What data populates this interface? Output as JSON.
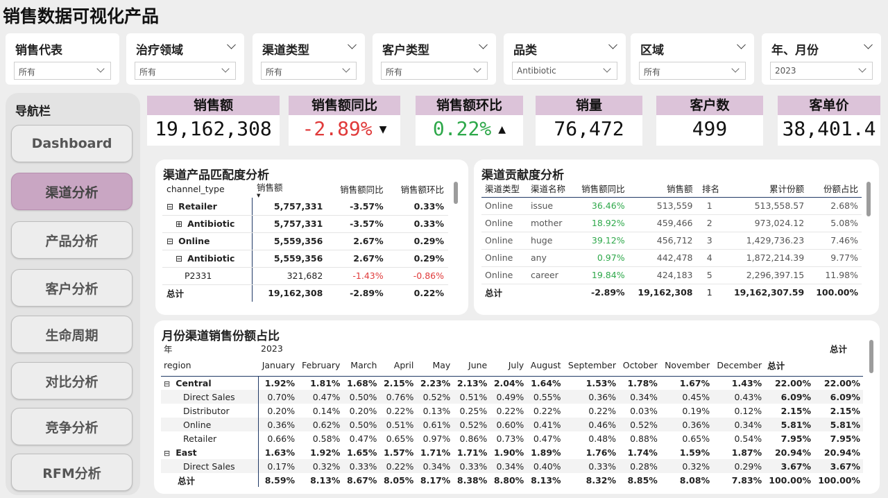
{
  "title": "销售数据可视化产品",
  "slicers": [
    {
      "label": "销售代表",
      "value": "所有"
    },
    {
      "label": "治疗领域",
      "value": "所有"
    },
    {
      "label": "渠道类型",
      "value": "所有"
    },
    {
      "label": "客户类型",
      "value": "所有"
    },
    {
      "label": "品类",
      "value": "Antibiotic"
    },
    {
      "label": "区域",
      "value": "所有"
    },
    {
      "label": "年、月份",
      "value": "2023"
    }
  ],
  "nav": {
    "title": "导航栏",
    "items": [
      "Dashboard",
      "渠道分析",
      "产品分析",
      "客户分析",
      "生命周期",
      "对比分析",
      "竞争分析",
      "RFM分析"
    ],
    "active": 1
  },
  "kpis": [
    {
      "label": "销售额",
      "value": "19,162,308"
    },
    {
      "label": "销售额同比",
      "value": "-2.89%",
      "arrow": "▼"
    },
    {
      "label": "销售额环比",
      "value": "0.22%",
      "arrow": "▲"
    },
    {
      "label": "销量",
      "value": "76,472"
    },
    {
      "label": "客户数",
      "value": "499"
    },
    {
      "label": "客单价",
      "value": "38,401.4"
    }
  ],
  "match": {
    "title": "渠道产品匹配度分析",
    "headers": [
      "channel_type",
      "销售额",
      "销售额同比",
      "销售额环比"
    ],
    "rows": [
      {
        "name": "Retailer",
        "exp": "⊟",
        "level": 0,
        "bold": true,
        "v": [
          "5,757,331",
          "-3.57%",
          "0.33%"
        ]
      },
      {
        "name": "Antibiotic",
        "exp": "⊞",
        "level": 1,
        "bold": true,
        "v": [
          "5,757,331",
          "-3.57%",
          "0.33%"
        ]
      },
      {
        "name": "Online",
        "exp": "⊟",
        "level": 0,
        "bold": true,
        "v": [
          "5,559,356",
          "2.67%",
          "0.29%"
        ]
      },
      {
        "name": "Antibiotic",
        "exp": "⊟",
        "level": 1,
        "bold": true,
        "v": [
          "5,559,356",
          "2.67%",
          "0.29%"
        ]
      },
      {
        "name": "P2331",
        "exp": "",
        "level": 2,
        "bold": false,
        "v": [
          "321,682",
          "-1.43%",
          "-0.86%"
        ],
        "red": true
      },
      {
        "name": "总计",
        "exp": "",
        "level": 0,
        "bold": true,
        "v": [
          "19,162,308",
          "-2.89%",
          "0.22%"
        ]
      }
    ]
  },
  "contrib": {
    "title": "渠道贡献度分析",
    "headers": [
      "渠道类型",
      "渠道名称",
      "销售额同比",
      "销售额",
      "排名",
      "累计份额",
      "份额占比"
    ],
    "rows": [
      [
        "Online",
        "issue",
        "36.46%",
        "513,559",
        "1",
        "513,558.57",
        "2.68%"
      ],
      [
        "Online",
        "mother",
        "18.92%",
        "459,466",
        "2",
        "973,024.12",
        "5.08%"
      ],
      [
        "Online",
        "huge",
        "39.12%",
        "456,712",
        "3",
        "1,429,736.23",
        "7.46%"
      ],
      [
        "Online",
        "any",
        "0.97%",
        "442,478",
        "4",
        "1,872,214.39",
        "9.77%"
      ],
      [
        "Online",
        "career",
        "19.84%",
        "424,183",
        "5",
        "2,296,397.15",
        "11.98%"
      ]
    ],
    "total": [
      "总计",
      "",
      "-2.89%",
      "19,162,308",
      "1",
      "19,162,307.59",
      "100.00%"
    ]
  },
  "monthly": {
    "title": "月份渠道销售份额占比",
    "year_label": "年",
    "region_label": "region",
    "year": "2023",
    "total_label": "总计",
    "months": [
      "January",
      "February",
      "March",
      "April",
      "May",
      "June",
      "July",
      "August",
      "September",
      "October",
      "November",
      "December"
    ],
    "rows": [
      {
        "name": "Central",
        "grp": true,
        "v": [
          "1.92%",
          "1.81%",
          "1.68%",
          "2.15%",
          "2.23%",
          "2.13%",
          "2.04%",
          "1.64%",
          "1.53%",
          "1.78%",
          "1.67%",
          "1.43%",
          "22.00%",
          "22.00%"
        ]
      },
      {
        "name": "Direct Sales",
        "grp": false,
        "v": [
          "0.70%",
          "0.47%",
          "0.50%",
          "0.76%",
          "0.52%",
          "0.51%",
          "0.49%",
          "0.55%",
          "0.36%",
          "0.34%",
          "0.45%",
          "0.43%",
          "6.09%",
          "6.09%"
        ]
      },
      {
        "name": "Distributor",
        "grp": false,
        "v": [
          "0.20%",
          "0.14%",
          "0.20%",
          "0.22%",
          "0.13%",
          "0.25%",
          "0.22%",
          "0.22%",
          "0.22%",
          "0.03%",
          "0.19%",
          "0.12%",
          "2.15%",
          "2.15%"
        ]
      },
      {
        "name": "Online",
        "grp": false,
        "v": [
          "0.36%",
          "0.62%",
          "0.50%",
          "0.51%",
          "0.61%",
          "0.52%",
          "0.60%",
          "0.41%",
          "0.46%",
          "0.52%",
          "0.36%",
          "0.34%",
          "5.81%",
          "5.81%"
        ]
      },
      {
        "name": "Retailer",
        "grp": false,
        "v": [
          "0.66%",
          "0.58%",
          "0.47%",
          "0.65%",
          "0.97%",
          "0.86%",
          "0.73%",
          "0.47%",
          "0.48%",
          "0.88%",
          "0.65%",
          "0.54%",
          "7.95%",
          "7.95%"
        ]
      },
      {
        "name": "East",
        "grp": true,
        "v": [
          "1.63%",
          "1.92%",
          "1.65%",
          "1.57%",
          "1.71%",
          "1.71%",
          "1.90%",
          "1.89%",
          "1.76%",
          "1.74%",
          "1.59%",
          "1.87%",
          "20.94%",
          "20.94%"
        ]
      },
      {
        "name": "Direct Sales",
        "grp": false,
        "v": [
          "0.17%",
          "0.32%",
          "0.33%",
          "0.22%",
          "0.34%",
          "0.33%",
          "0.34%",
          "0.40%",
          "0.33%",
          "0.28%",
          "0.32%",
          "0.29%",
          "3.67%",
          "3.67%"
        ]
      },
      {
        "name": "总计",
        "grp": true,
        "total": true,
        "v": [
          "8.59%",
          "8.13%",
          "8.67%",
          "8.05%",
          "8.17%",
          "8.38%",
          "8.80%",
          "8.13%",
          "8.32%",
          "8.85%",
          "8.08%",
          "7.83%",
          "100.00%",
          "100.00%"
        ]
      }
    ]
  },
  "colors": {
    "kpi_header": "#dcc3d9",
    "nav_active": "#c9a6c3",
    "negative": "#e03a3a",
    "positive": "#2ea84a"
  }
}
